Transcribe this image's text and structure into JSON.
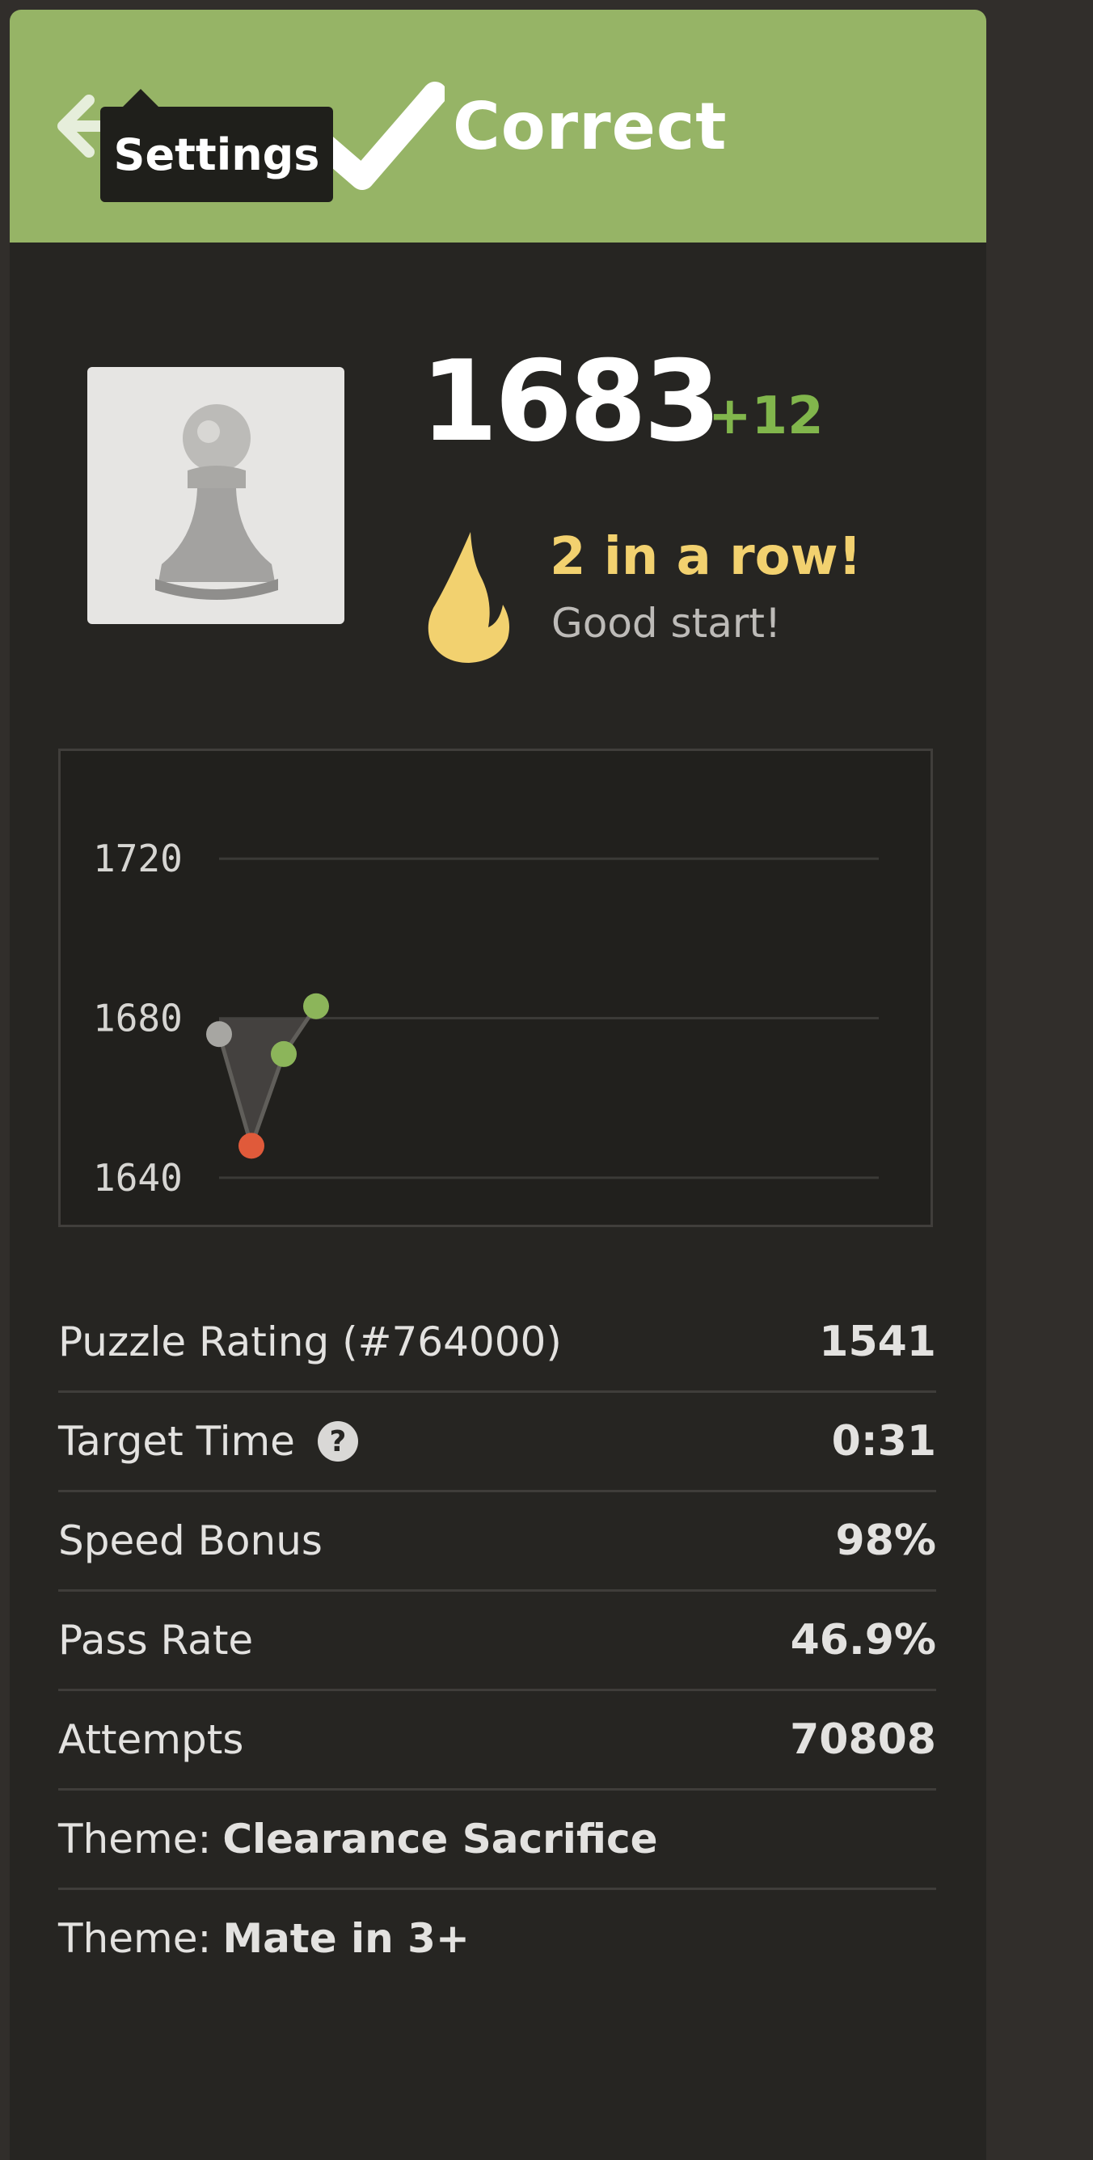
{
  "header": {
    "title": "Correct",
    "tooltip": "Settings",
    "background_color": "#96b466",
    "icons": [
      "back-arrow-icon",
      "checkmark-icon"
    ]
  },
  "player": {
    "rating": "1683",
    "rating_change": "+12",
    "streak_text": "2 in a row!",
    "streak_sub": "Good start!",
    "icons": [
      "pawn-avatar-icon",
      "flame-icon"
    ]
  },
  "chart_data": {
    "type": "line",
    "title": "",
    "xlabel": "",
    "ylabel": "",
    "y_ticks": [
      "1720",
      "1680",
      "1640"
    ],
    "ylim": [
      1627,
      1747
    ],
    "grid": true,
    "x": [
      1,
      2,
      3,
      4
    ],
    "series": [
      {
        "values": [
          1676,
          1648,
          1671,
          1683
        ],
        "point_status": [
          "start",
          "fail",
          "pass",
          "pass"
        ]
      }
    ],
    "colors": {
      "start": "#a7a6a2",
      "fail": "#e05a3a",
      "pass": "#8cb55a",
      "fill": "#4a4845"
    }
  },
  "stats": [
    {
      "label": "Puzzle Rating (#764000)",
      "value": "1541"
    },
    {
      "label": "Target Time",
      "value": "0:31",
      "help_icon": "?"
    },
    {
      "label": "Speed Bonus",
      "value": "98%"
    },
    {
      "label": "Pass Rate",
      "value": "46.9%"
    },
    {
      "label": "Attempts",
      "value": "70808"
    }
  ],
  "themes": [
    {
      "prefix": "Theme:",
      "name": "Clearance Sacrifice"
    },
    {
      "prefix": "Theme:",
      "name": "Mate in 3+"
    }
  ]
}
